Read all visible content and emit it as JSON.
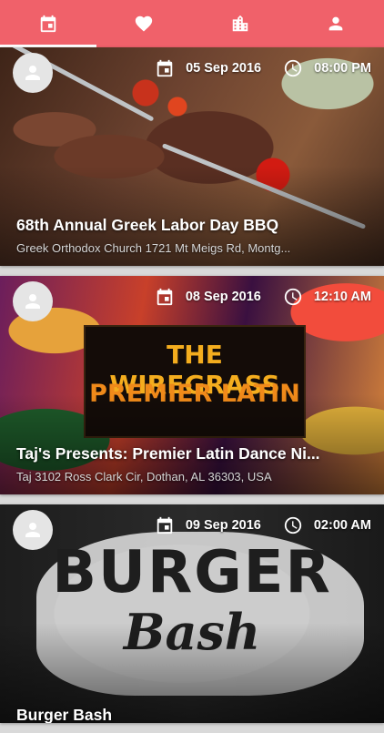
{
  "tabs": [
    {
      "icon": "calendar-icon",
      "active": true
    },
    {
      "icon": "heart-icon",
      "active": false
    },
    {
      "icon": "city-icon",
      "active": false
    },
    {
      "icon": "person-icon",
      "active": false
    }
  ],
  "colors": {
    "accent": "#f0616a"
  },
  "events": [
    {
      "date": "05 Sep 2016",
      "time": "08:00 PM",
      "title": "68th Annual Greek Labor Day BBQ",
      "address": "Greek Orthodox Church 1721 Mt Meigs Rd, Montg..."
    },
    {
      "date": "08 Sep 2016",
      "time": "12:10 AM",
      "title": "Taj's Presents: Premier Latin Dance Ni...",
      "address": "Taj 3102 Ross Clark Cir, Dothan, AL 36303, USA",
      "poster": {
        "line1": "THE WIREGRASS",
        "line2": "PREMIER LATIN"
      }
    },
    {
      "date": "09 Sep 2016",
      "time": "02:00 AM",
      "title": "Burger Bash",
      "address": "",
      "poster": {
        "line1": "BURGER",
        "line2": "Bash"
      }
    }
  ]
}
